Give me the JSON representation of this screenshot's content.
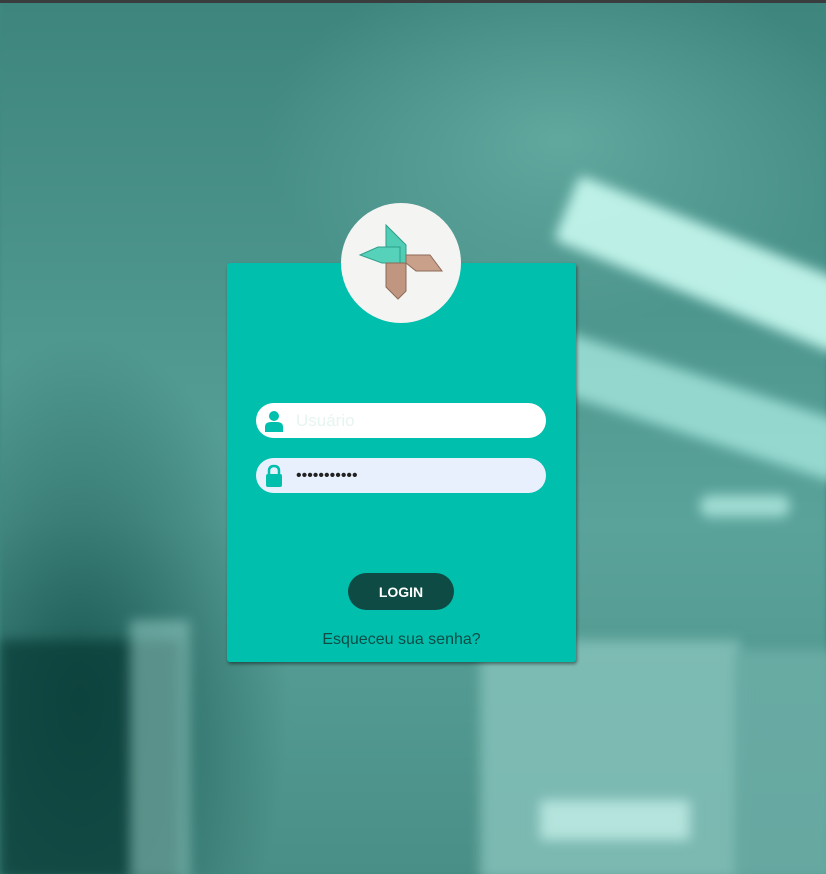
{
  "login_form": {
    "username": {
      "placeholder": "Usuário",
      "value": "",
      "icon": "user-icon"
    },
    "password": {
      "value": "•••••••••••",
      "icon": "lock-icon"
    },
    "login_label": "LOGIN",
    "forgot_password_label": "Esqueceu sua senha?"
  },
  "logo": {
    "icon": "pinwheel-logo-icon"
  },
  "colors": {
    "card": "#00bfad",
    "button": "#0d4b44",
    "link": "#0f4c46",
    "logo_teal": "#4fcdb5",
    "logo_tan": "#c19680"
  }
}
